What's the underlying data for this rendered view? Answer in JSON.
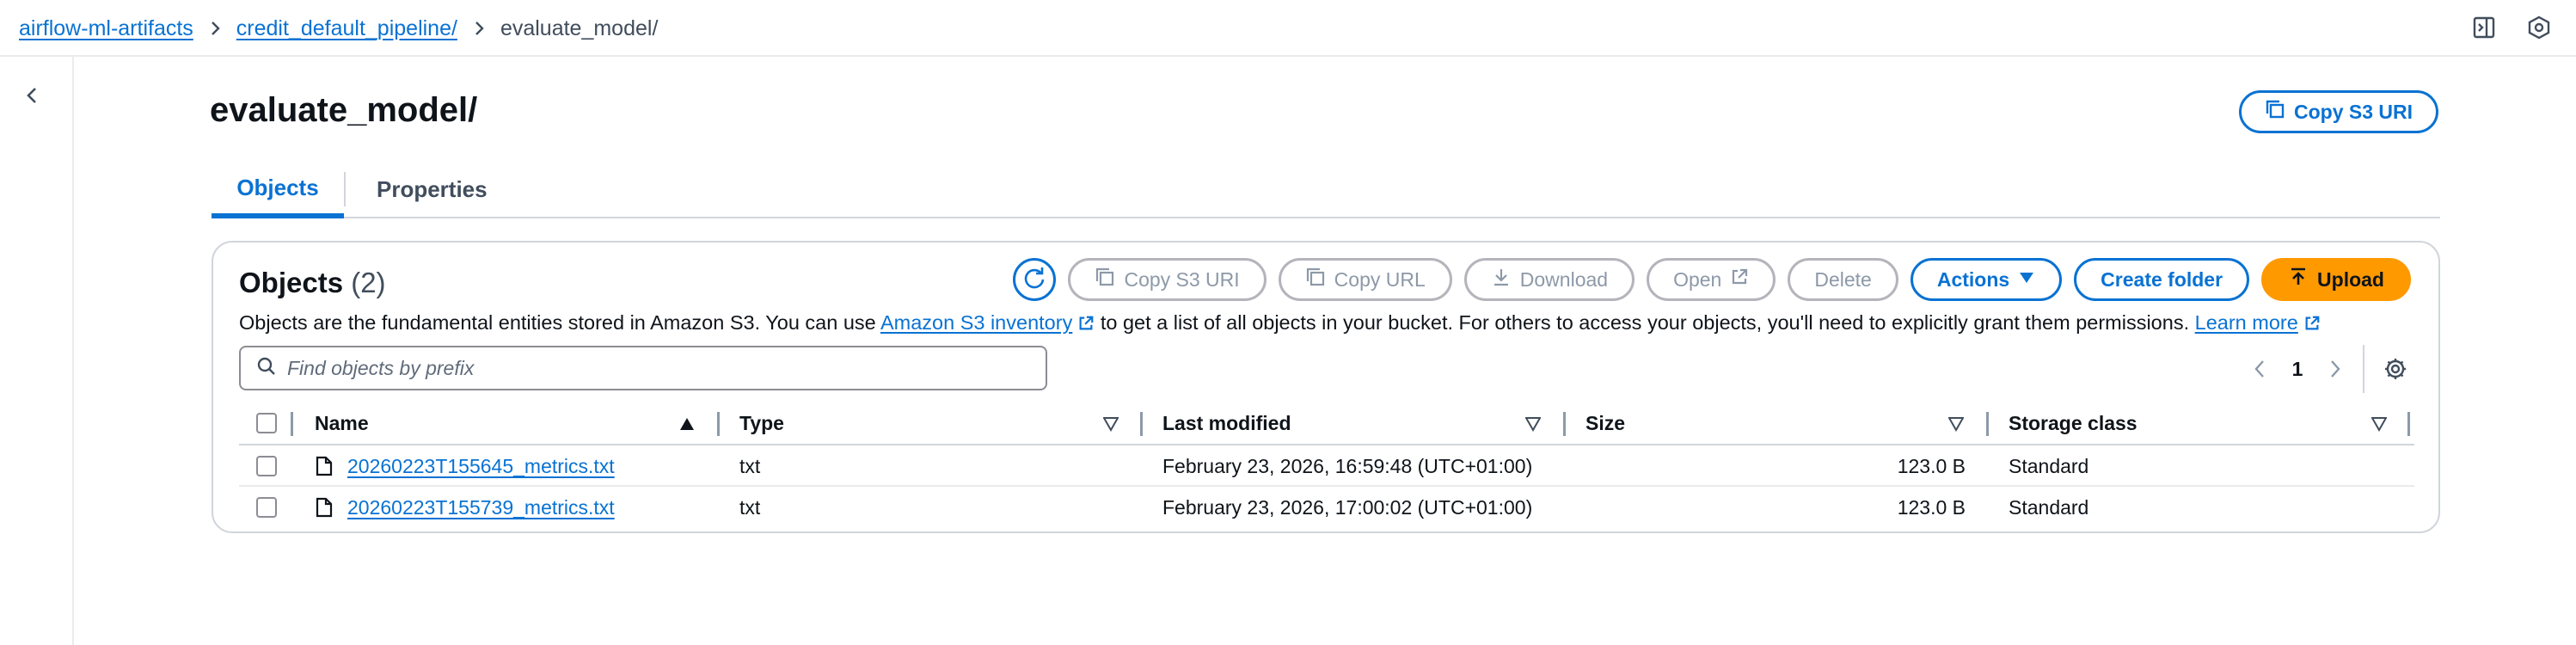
{
  "breadcrumbs": [
    {
      "label": "airflow-ml-artifacts"
    },
    {
      "label": "credit_default_pipeline/"
    },
    {
      "label": "evaluate_model/"
    }
  ],
  "header": {
    "title": "evaluate_model/",
    "copy_s3_uri_label": "Copy S3 URI"
  },
  "tabs": [
    {
      "label": "Objects",
      "selected": true
    },
    {
      "label": "Properties",
      "selected": false
    }
  ],
  "objects_panel": {
    "title": "Objects",
    "count": "(2)",
    "buttons": {
      "copy_s3_uri": "Copy S3 URI",
      "copy_url": "Copy URL",
      "download": "Download",
      "open": "Open",
      "delete": "Delete",
      "actions": "Actions",
      "create_folder": "Create folder",
      "upload": "Upload"
    },
    "description": {
      "before": "Objects are the fundamental entities stored in Amazon S3. You can use ",
      "link1": "Amazon S3 inventory",
      "middle": " to get a list of all objects in your bucket. For others to access your objects, you'll need to explicitly grant them permissions. ",
      "link2": "Learn more"
    },
    "search_placeholder": "Find objects by prefix",
    "page_number": "1"
  },
  "table": {
    "columns": [
      "Name",
      "Type",
      "Last modified",
      "Size",
      "Storage class"
    ],
    "rows": [
      {
        "name": "20260223T155645_metrics.txt",
        "type": "txt",
        "last_modified": "February 23, 2026, 16:59:48 (UTC+01:00)",
        "size": "123.0 B",
        "storage_class": "Standard"
      },
      {
        "name": "20260223T155739_metrics.txt",
        "type": "txt",
        "last_modified": "February 23, 2026, 17:00:02 (UTC+01:00)",
        "size": "123.0 B",
        "storage_class": "Standard"
      }
    ]
  },
  "colors": {
    "link": "#0972d3",
    "primary_button": "#ff9900",
    "disabled": "#8d99a8",
    "border": "#d1d5db"
  },
  "icons": [
    "chevron-right-icon",
    "side-panel-icon",
    "settings-hex-icon",
    "chevron-left-icon",
    "refresh-icon",
    "copy-icon",
    "download-icon",
    "external-link-icon",
    "caret-down-icon",
    "upload-icon",
    "search-icon",
    "gear-icon",
    "file-icon",
    "sort-asc-icon",
    "sort-desc-icon"
  ]
}
